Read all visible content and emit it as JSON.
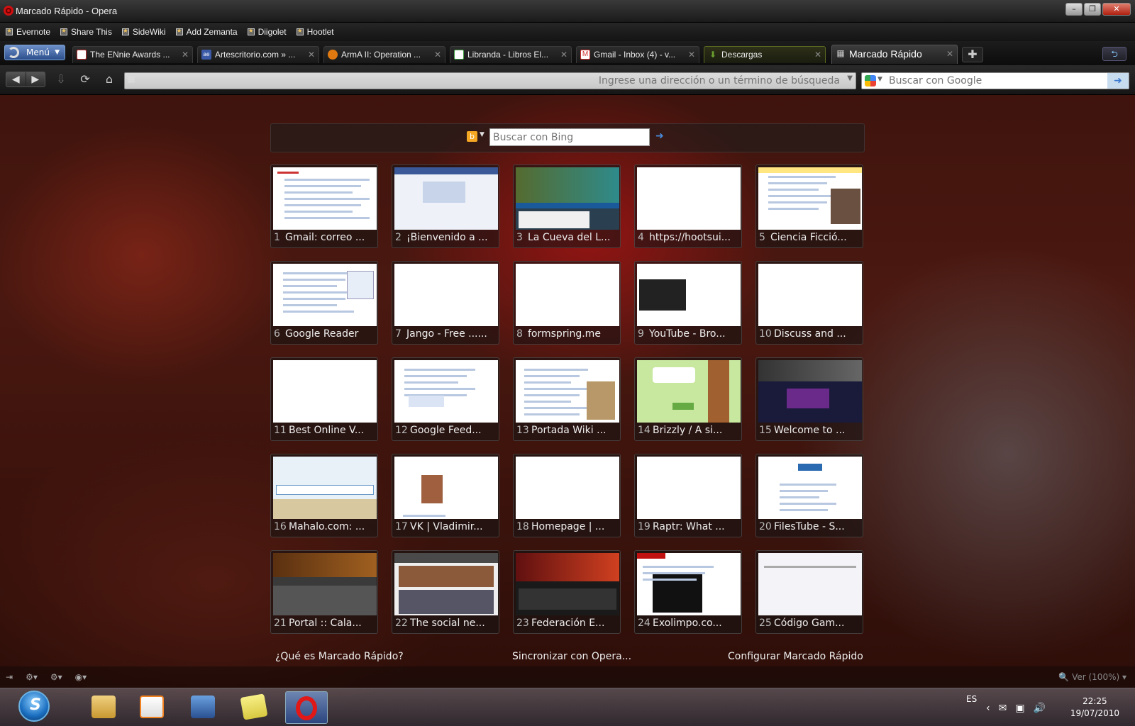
{
  "window": {
    "title": "Marcado Rápido - Opera"
  },
  "bookmarks": [
    {
      "label": "Evernote"
    },
    {
      "label": "Share This"
    },
    {
      "label": "SideWiki"
    },
    {
      "label": "Add Zemanta"
    },
    {
      "label": "Diigolet"
    },
    {
      "label": "Hootlet"
    }
  ],
  "menu": {
    "label": "Menú"
  },
  "tabs": [
    {
      "label": "The ENnie Awards ...",
      "color": "#c03030"
    },
    {
      "label": "Artescritorio.com » ...",
      "color": "#3a5aa8"
    },
    {
      "label": "ArmA II: Operation ...",
      "color": "#e07a10"
    },
    {
      "label": "Libranda - Libros El...",
      "color": "#40a040"
    },
    {
      "label": "Gmail - Inbox (4) - v...",
      "color": "#d03030"
    },
    {
      "label": "Descargas",
      "color": "#6aa030"
    },
    {
      "label": "Marcado Rápido",
      "color": "#888888"
    }
  ],
  "address": {
    "placeholder": "Ingrese una dirección o un término de búsqueda"
  },
  "search": {
    "placeholder": "Buscar con Google"
  },
  "speed_dial": {
    "bing_placeholder": "Buscar con Bing",
    "dials": [
      {
        "num": "1",
        "label": "Gmail: correo ..."
      },
      {
        "num": "2",
        "label": "¡Bienvenido a ..."
      },
      {
        "num": "3",
        "label": "La Cueva del L..."
      },
      {
        "num": "4",
        "label": "https://hootsui..."
      },
      {
        "num": "5",
        "label": "Ciencia Ficció..."
      },
      {
        "num": "6",
        "label": "Google Reader"
      },
      {
        "num": "7",
        "label": "Jango - Free ......"
      },
      {
        "num": "8",
        "label": "formspring.me"
      },
      {
        "num": "9",
        "label": "YouTube - Bro..."
      },
      {
        "num": "10",
        "label": "Discuss and ..."
      },
      {
        "num": "11",
        "label": "Best Online V..."
      },
      {
        "num": "12",
        "label": "Google Feed..."
      },
      {
        "num": "13",
        "label": "Portada Wiki ..."
      },
      {
        "num": "14",
        "label": "Brizzly / A si..."
      },
      {
        "num": "15",
        "label": "Welcome to ..."
      },
      {
        "num": "16",
        "label": "Mahalo.com: ..."
      },
      {
        "num": "17",
        "label": "VK | Vladimir..."
      },
      {
        "num": "18",
        "label": "Homepage | ..."
      },
      {
        "num": "19",
        "label": "Raptr: What ..."
      },
      {
        "num": "20",
        "label": "FilesTube - S..."
      },
      {
        "num": "21",
        "label": "Portal :: Cala..."
      },
      {
        "num": "22",
        "label": "The social ne..."
      },
      {
        "num": "23",
        "label": "Federación E..."
      },
      {
        "num": "24",
        "label": "Exolimpo.co..."
      },
      {
        "num": "25",
        "label": "Código Gam..."
      }
    ],
    "links": {
      "what": "¿Qué es Marcado Rápido?",
      "sync": "Sincronizar con Opera...",
      "configure": "Configurar Marcado Rápido"
    }
  },
  "statusbar": {
    "zoom": "Ver (100%)"
  },
  "taskbar": {
    "lang": "ES",
    "time": "22:25",
    "date": "19/07/2010"
  }
}
